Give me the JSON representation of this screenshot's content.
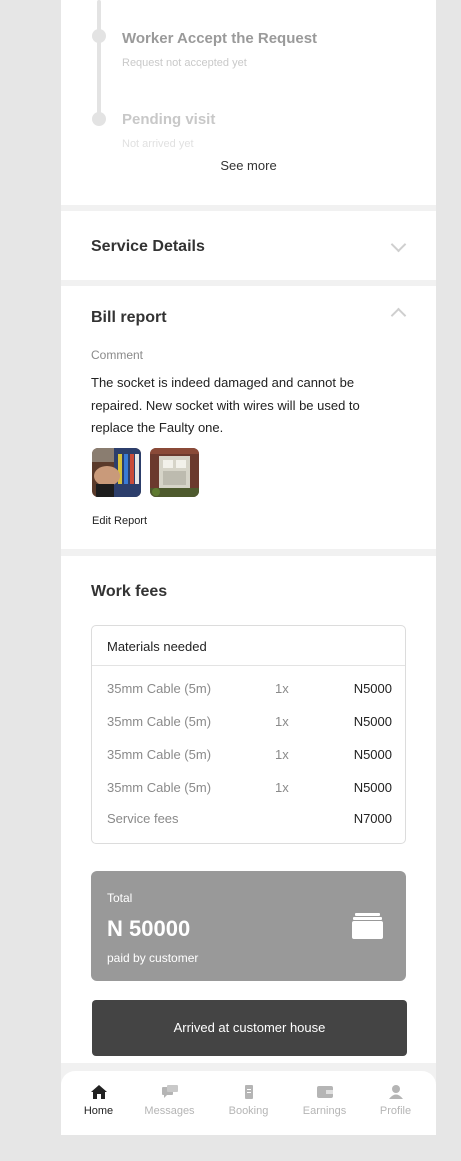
{
  "timeline": {
    "steps": [
      {
        "title": "Worker Accept the Request",
        "subtitle": "Request not accepted yet"
      },
      {
        "title": "Pending visit",
        "subtitle": "Not arrived yet"
      }
    ],
    "see_more": "See more"
  },
  "service_details": {
    "title": "Service Details"
  },
  "bill_report": {
    "title": "Bill report",
    "comment_label": "Comment",
    "comment": "The socket is indeed damaged and cannot be repaired. New socket with wires will be used to replace the Faulty one.",
    "edit_label": "Edit Report"
  },
  "work_fees": {
    "title": "Work fees",
    "materials_header": "Materials needed",
    "items": [
      {
        "name": "35mm Cable (5m)",
        "qty": "1x",
        "price": "N5000"
      },
      {
        "name": "35mm Cable (5m)",
        "qty": "1x",
        "price": "N5000"
      },
      {
        "name": "35mm Cable (5m)",
        "qty": "1x",
        "price": "N5000"
      },
      {
        "name": "35mm Cable (5m)",
        "qty": "1x",
        "price": "N5000"
      }
    ],
    "service_fee": {
      "name": "Service fees",
      "price": "N7000"
    }
  },
  "total": {
    "label": "Total",
    "amount": "N 50000",
    "sub": "paid by customer",
    "icon": "wallet-icon"
  },
  "action_button": "Arrived at customer house",
  "nav": {
    "items": [
      {
        "label": "Home",
        "icon": "home-icon",
        "active": true
      },
      {
        "label": "Messages",
        "icon": "messages-icon",
        "active": false
      },
      {
        "label": "Booking",
        "icon": "booking-icon",
        "active": false
      },
      {
        "label": "Earnings",
        "icon": "wallet-icon",
        "active": false
      },
      {
        "label": "Profile",
        "icon": "profile-icon",
        "active": false
      }
    ]
  },
  "colors": {
    "card": "#ffffff",
    "background": "#f1f1f1",
    "button": "#444444",
    "total_card": "#999999"
  }
}
